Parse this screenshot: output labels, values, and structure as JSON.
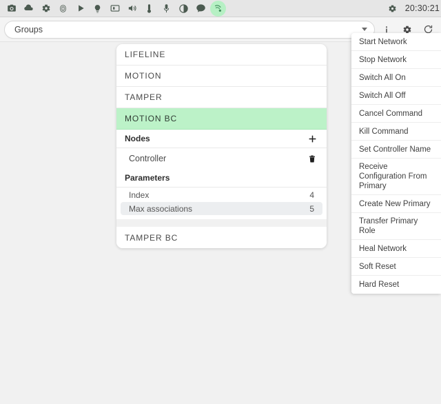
{
  "topbar": {
    "icons": [
      {
        "name": "camera-icon",
        "label": "Camera"
      },
      {
        "name": "cloud-icon",
        "label": "Cloud"
      },
      {
        "name": "gear-icon",
        "label": "Settings"
      },
      {
        "name": "fingerprint-icon",
        "label": "Fingerprint"
      },
      {
        "name": "play-icon",
        "label": "Play"
      },
      {
        "name": "bulb-icon",
        "label": "Light"
      },
      {
        "name": "media-icon",
        "label": "Media"
      },
      {
        "name": "volume-icon",
        "label": "Volume"
      },
      {
        "name": "thermometer-icon",
        "label": "Thermostat"
      },
      {
        "name": "microphone-icon",
        "label": "Microphone"
      },
      {
        "name": "contrast-icon",
        "label": "Contrast"
      },
      {
        "name": "chat-icon",
        "label": "Chat"
      },
      {
        "name": "zwave-icon",
        "label": "Z-Wave"
      }
    ],
    "active_icon_index": 12,
    "status_gear": "gear-icon",
    "clock": "20:30:21",
    "background": "#e6e6e6",
    "active_highlight": "#b6f0c4"
  },
  "combo_row": {
    "selected_value": "Groups",
    "placeholder": "Groups",
    "dropdown_icon": "chevron-down-icon",
    "actions": [
      {
        "name": "info-icon",
        "label": "Information"
      },
      {
        "name": "gear-icon",
        "label": "Settings"
      },
      {
        "name": "refresh-icon",
        "label": "Refresh"
      }
    ]
  },
  "card": {
    "groups": [
      {
        "label": "LIFELINE",
        "selected": false
      },
      {
        "label": "MOTION",
        "selected": false
      },
      {
        "label": "TAMPER",
        "selected": false
      },
      {
        "label": "MOTION BC",
        "selected": true
      }
    ],
    "selected_color": "#bcf2c8",
    "nodes_section": {
      "title": "Nodes",
      "add_icon": "plus-icon",
      "nodes": [
        {
          "label": "Controller",
          "delete_icon": "trash-icon"
        }
      ]
    },
    "parameters_section": {
      "title": "Parameters",
      "rows": [
        {
          "label": "Index",
          "value": "4",
          "highlight": false
        },
        {
          "label": "Max associations",
          "value": "5",
          "highlight": true
        }
      ]
    },
    "trailing_groups": [
      {
        "label": "TAMPER BC",
        "selected": false
      }
    ]
  },
  "menu": {
    "items": [
      {
        "label": "Start Network"
      },
      {
        "label": "Stop Network"
      },
      {
        "label": "Switch All On"
      },
      {
        "label": "Switch All Off"
      },
      {
        "label": "Cancel Command"
      },
      {
        "label": "Kill Command"
      },
      {
        "label": "Set Controller Name"
      },
      {
        "label": "Receive Configuration From Primary"
      },
      {
        "label": "Create New Primary"
      },
      {
        "label": "Transfer Primary Role"
      },
      {
        "label": "Heal Network"
      },
      {
        "label": "Soft Reset"
      },
      {
        "label": "Hard Reset"
      }
    ]
  },
  "page": {
    "background": "#f1f1f1"
  }
}
